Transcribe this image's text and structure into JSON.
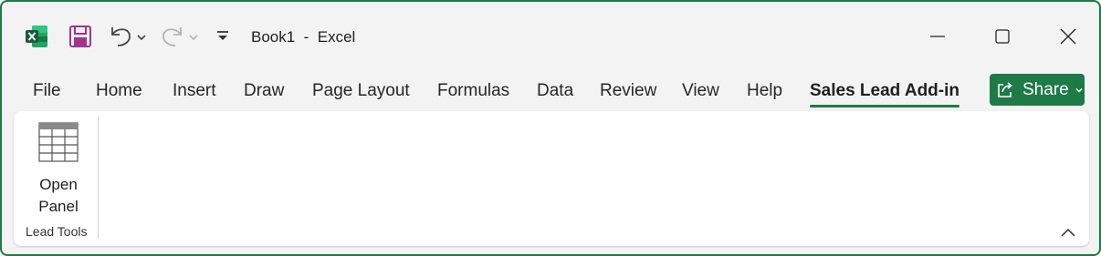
{
  "app": {
    "document_title": "Book1  -  Excel",
    "accent_color": "#1e7a46",
    "icons": {
      "logo": "excel-logo-icon",
      "save": "save-icon",
      "undo": "undo-icon",
      "redo": "redo-icon",
      "qat": "customize-quick-access-icon",
      "minimize": "minimize-icon",
      "maximize": "maximize-icon",
      "close": "close-icon"
    }
  },
  "ribbon_tabs": [
    {
      "label": "File"
    },
    {
      "label": "Home"
    },
    {
      "label": "Insert"
    },
    {
      "label": "Draw"
    },
    {
      "label": "Page Layout"
    },
    {
      "label": "Formulas"
    },
    {
      "label": "Data"
    },
    {
      "label": "Review"
    },
    {
      "label": "View"
    },
    {
      "label": "Help"
    },
    {
      "label": "Sales Lead Add-in",
      "active": true
    }
  ],
  "share": {
    "label": "Share"
  },
  "ribbon": {
    "groups": [
      {
        "label": "Lead Tools",
        "buttons": [
          {
            "label_line1": "Open",
            "label_line2": "Panel",
            "icon": "table-icon"
          }
        ]
      }
    ]
  }
}
